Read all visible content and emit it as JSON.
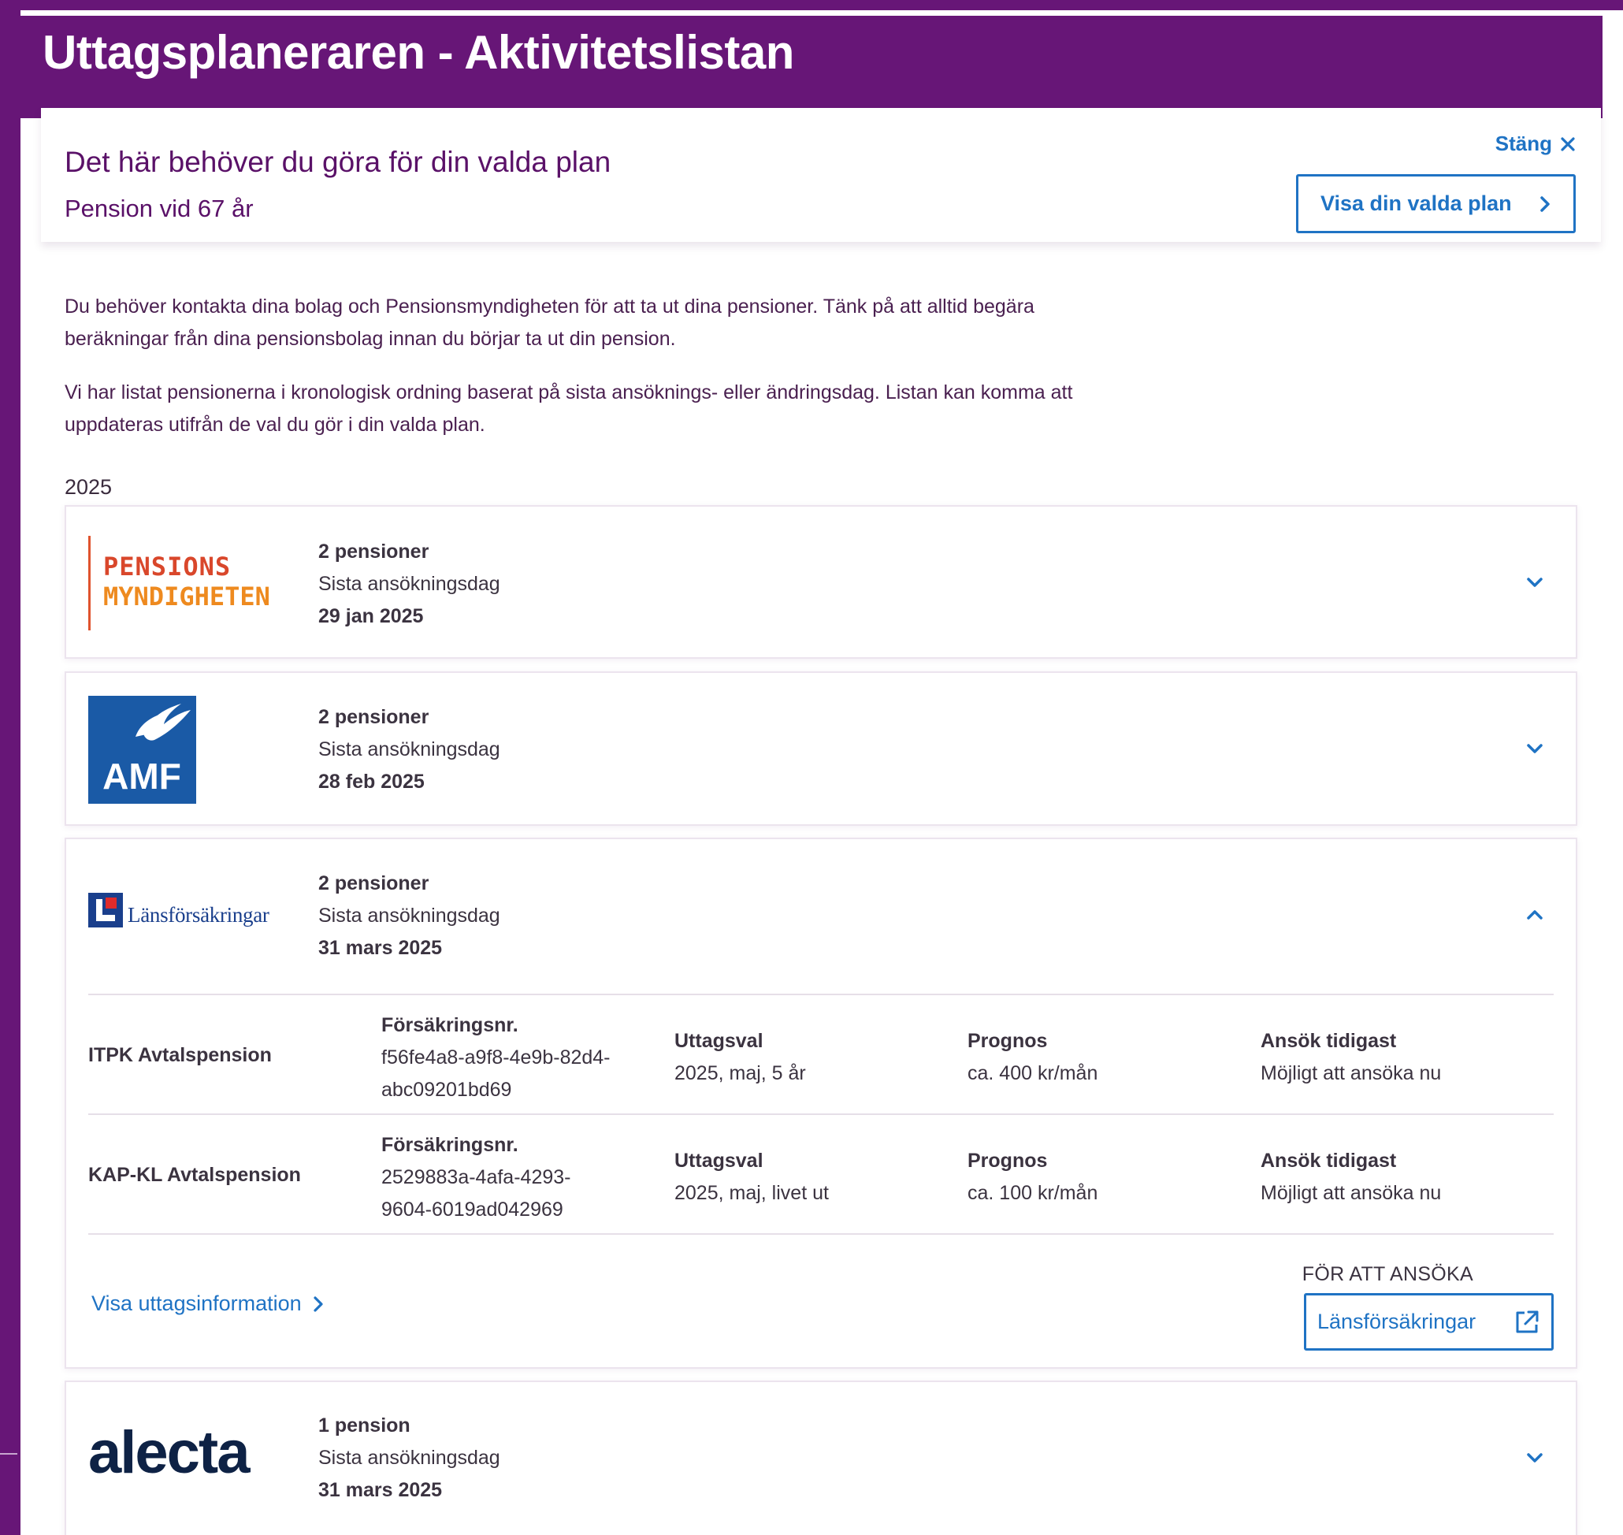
{
  "app": {
    "title": "Uttagsplaneraren - Aktivitetslistan"
  },
  "panel": {
    "heading": "Det här behöver du göra för din valda plan",
    "subheading": "Pension vid 67 år",
    "close_label": "Stäng",
    "show_plan_label": "Visa din valda plan",
    "intro": [
      "Du behöver kontakta dina bolag och Pensionsmyndigheten för att ta ut dina pensioner. Tänk på att alltid begära beräkningar från dina pensionsbolag innan du börjar ta ut din pension.",
      "Vi har listat pensionerna i kronologisk ordning baserat på sista ansöknings- eller ändringsdag. Listan kan komma att uppdateras utifrån de val du gör i din valda plan."
    ],
    "year": "2025"
  },
  "providers": [
    {
      "logo_l1": "PENSIONS",
      "logo_l2": "MYNDIGHETEN",
      "count": "2 pensioner",
      "deadline_label": "Sista ansökningsdag",
      "date": "29 jan 2025",
      "expanded": false
    },
    {
      "logo_text": "AMF",
      "count": "2 pensioner",
      "deadline_label": "Sista ansökningsdag",
      "date": "28 feb 2025",
      "expanded": false
    },
    {
      "logo_text": "Länsförsäkringar",
      "count": "2 pensioner",
      "deadline_label": "Sista ansökningsdag",
      "date": "31 mars 2025",
      "expanded": true,
      "details": [
        {
          "name": "ITPK Avtalspension",
          "policy_label": "Försäkringsnr.",
          "policy_l1": "f56fe4a8-a9f8-4e9b-82d4-",
          "policy_l2": "abc09201bd69",
          "choice_label": "Uttagsval",
          "choice": "2025, maj, 5 år",
          "forecast_label": "Prognos",
          "forecast": "ca. 400 kr/mån",
          "earliest_label": "Ansök tidigast",
          "earliest": "Möjligt att ansöka nu"
        },
        {
          "name": "KAP-KL Avtalspension",
          "policy_label": "Försäkringsnr.",
          "policy_l1": "2529883a-4afa-4293-",
          "policy_l2": "9604-6019ad042969",
          "choice_label": "Uttagsval",
          "choice": "2025, maj, livet ut",
          "forecast_label": "Prognos",
          "forecast": "ca. 100 kr/mån",
          "earliest_label": "Ansök tidigast",
          "earliest": "Möjligt att ansöka nu"
        }
      ],
      "info_link": "Visa uttagsinformation",
      "apply_label": "FÖR ATT ANSÖKA",
      "apply_button": "Länsförsäkringar"
    },
    {
      "logo_text": "alecta",
      "count": "1 pension",
      "deadline_label": "Sista ansökningsdag",
      "date": "31 mars 2025",
      "expanded": false
    }
  ],
  "colors": {
    "brand_purple": "#671677",
    "link_blue": "#1f73c4",
    "heading_purple": "#5a1168"
  },
  "icons": {
    "close": "close-icon",
    "chevron_right": "chevron-right-icon",
    "chevron_down": "chevron-down-icon",
    "chevron_up": "chevron-up-icon",
    "external": "external-link-icon"
  }
}
